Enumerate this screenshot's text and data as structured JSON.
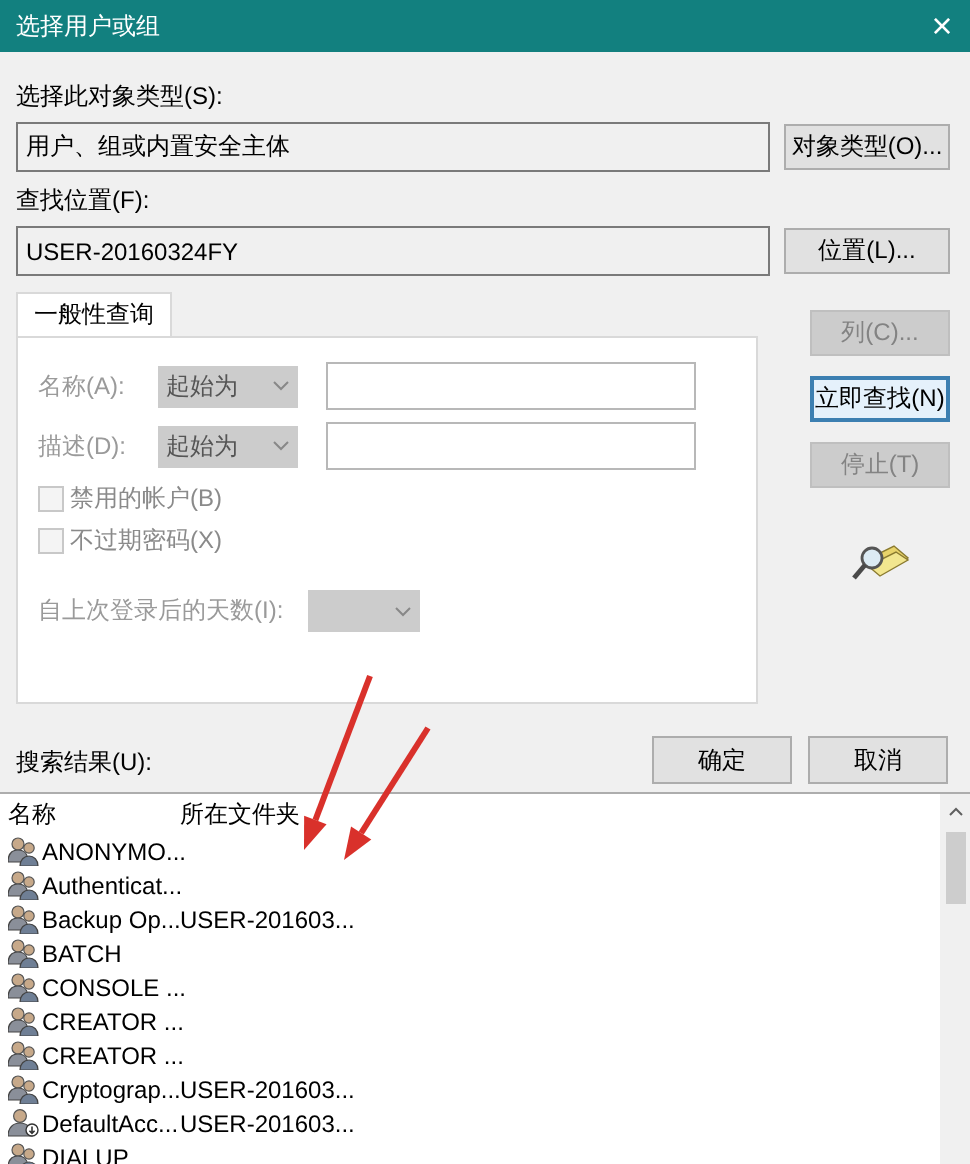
{
  "window": {
    "title": "选择用户或组",
    "close": "×"
  },
  "object_type": {
    "label": "选择此对象类型(S):",
    "value": "用户、组或内置安全主体",
    "button": "对象类型(O)..."
  },
  "location": {
    "label": "查找位置(F):",
    "value": "USER-20160324FY",
    "button": "位置(L)..."
  },
  "tabs": [
    {
      "label": "一般性查询",
      "selected": true
    }
  ],
  "query": {
    "rows": [
      {
        "label": "名称(A):",
        "mode": "起始为",
        "disabled": true
      },
      {
        "label": "描述(D):",
        "mode": "起始为",
        "disabled": true
      }
    ],
    "checkboxes": [
      {
        "label": "禁用的帐户(B)",
        "checked": false,
        "disabled": true
      },
      {
        "label": "不过期密码(X)",
        "checked": false,
        "disabled": true
      }
    ],
    "days_label": "自上次登录后的天数(I):"
  },
  "side_buttons": [
    {
      "label": "列(C)...",
      "disabled": true,
      "default": false
    },
    {
      "label": "立即查找(N)",
      "disabled": false,
      "default": true
    },
    {
      "label": "停止(T)",
      "disabled": true,
      "default": false
    }
  ],
  "ok": "确定",
  "cancel": "取消",
  "results": {
    "label": "搜索结果(U):",
    "columns": [
      "名称",
      "所在文件夹"
    ],
    "rows": [
      {
        "kind": "group",
        "name": "ANONYMO...",
        "folder": ""
      },
      {
        "kind": "group",
        "name": "Authenticat...",
        "folder": ""
      },
      {
        "kind": "group",
        "name": "Backup Op...",
        "folder": "USER-201603..."
      },
      {
        "kind": "group",
        "name": "BATCH",
        "folder": ""
      },
      {
        "kind": "group",
        "name": "CONSOLE ...",
        "folder": ""
      },
      {
        "kind": "group",
        "name": "CREATOR ...",
        "folder": ""
      },
      {
        "kind": "group",
        "name": "CREATOR ...",
        "folder": ""
      },
      {
        "kind": "group",
        "name": "Cryptograp...",
        "folder": "USER-201603..."
      },
      {
        "kind": "user",
        "name": "DefaultAcc...",
        "folder": "USER-201603..."
      },
      {
        "kind": "group",
        "name": "DIALUP",
        "folder": ""
      }
    ]
  }
}
